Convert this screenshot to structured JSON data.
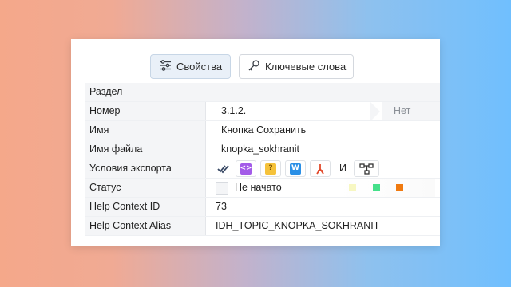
{
  "tabs": [
    {
      "label": "Свойства",
      "icon": "sliders-icon",
      "active": true
    },
    {
      "label": "Ключевые слова",
      "icon": "key-icon",
      "active": false
    }
  ],
  "section": {
    "label": "Раздел"
  },
  "number": {
    "label": "Номер",
    "value": "3.1.2.",
    "next": "Нет"
  },
  "name": {
    "label": "Имя",
    "value": "Кнопка Сохранить"
  },
  "file_name": {
    "label": "Имя файла",
    "value": "knopka_sokhranit"
  },
  "export": {
    "label": "Условия экспорта",
    "and_label": "И",
    "icons": [
      "checks-icon",
      "html-icon",
      "chm-help-icon",
      "word-icon",
      "pdf-icon"
    ],
    "tree_icon": "tree-structure-icon",
    "colors": {
      "html": "#a35be8",
      "chm": "#f5c23b",
      "word": "#2a8fe6",
      "pdf": "#e24a2c",
      "checks": "#3a4a66"
    }
  },
  "status": {
    "label": "Статус",
    "value": "Не начато",
    "colors": [
      "#f7f7c2",
      "#45e08a",
      "#f07a10"
    ]
  },
  "help_context_id": {
    "label": "Help Context ID",
    "value": "73"
  },
  "help_context_alias": {
    "label": "Help Context Alias",
    "value": "IDH_TOPIC_KNOPKA_SOKHRANIT"
  }
}
